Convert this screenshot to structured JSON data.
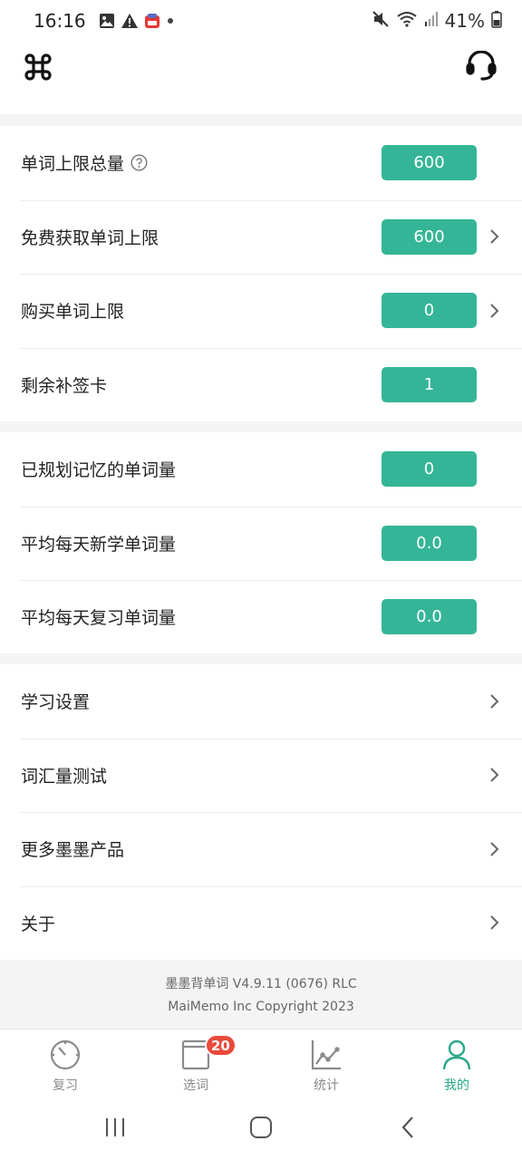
{
  "status_bar": {
    "time": "16:16",
    "battery": "41%"
  },
  "colors": {
    "accent": "#35b597",
    "badge": "#e94b3c",
    "active_nav": "#2aa78a"
  },
  "header": {
    "left_icon": "command-icon",
    "right_icon": "headset-icon"
  },
  "section_limits": [
    {
      "label": "单词上限总量",
      "value": "600",
      "help": true,
      "chevron": false
    },
    {
      "label": "免费获取单词上限",
      "value": "600",
      "chevron": true
    },
    {
      "label": "购买单词上限",
      "value": "0",
      "chevron": true
    },
    {
      "label": "剩余补签卡",
      "value": "1",
      "chevron": false
    }
  ],
  "section_stats": [
    {
      "label": "已规划记忆的单词量",
      "value": "0"
    },
    {
      "label": "平均每天新学单词量",
      "value": "0.0"
    },
    {
      "label": "平均每天复习单词量",
      "value": "0.0"
    }
  ],
  "section_links": [
    {
      "label": "学习设置"
    },
    {
      "label": "词汇量测试"
    },
    {
      "label": "更多墨墨产品"
    },
    {
      "label": "关于"
    }
  ],
  "footer": {
    "version": "墨墨背单词 V4.9.11 (0676) RLC",
    "copyright": "MaiMemo Inc Copyright 2023"
  },
  "bottom_nav": [
    {
      "label": "复习",
      "icon": "gauge-icon"
    },
    {
      "label": "选词",
      "icon": "book-icon",
      "badge": "20"
    },
    {
      "label": "统计",
      "icon": "chart-icon"
    },
    {
      "label": "我的",
      "icon": "person-icon",
      "active": true
    }
  ]
}
